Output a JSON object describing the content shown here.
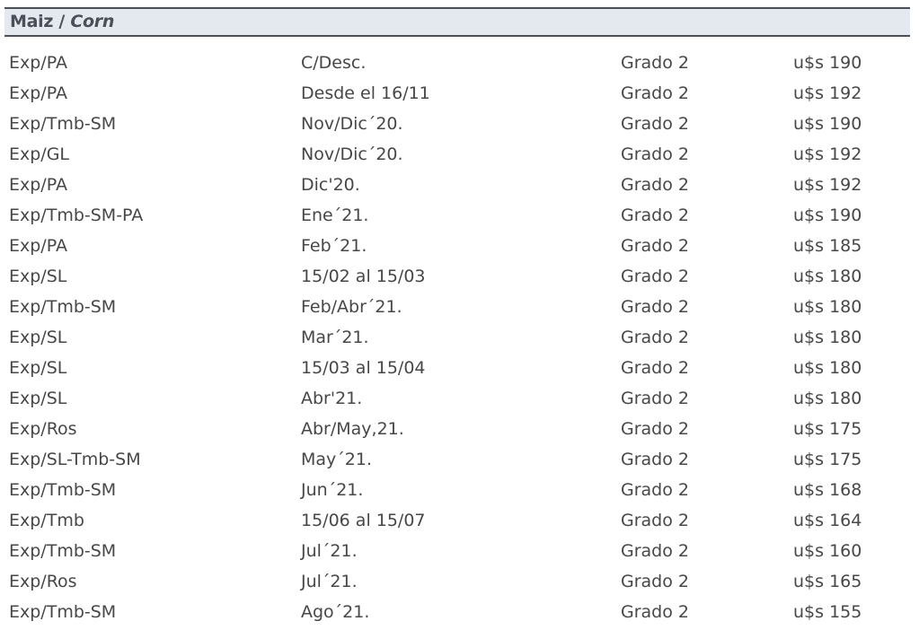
{
  "section": {
    "title_es": "Maiz",
    "separator": " / ",
    "title_en": "Corn"
  },
  "rows": [
    [
      "Exp/PA",
      "C/Desc.",
      "Grado 2",
      "u$s 190"
    ],
    [
      "Exp/PA",
      "Desde el 16/11",
      "Grado 2",
      "u$s 192"
    ],
    [
      "Exp/Tmb-SM",
      "Nov/Dic´20.",
      "Grado 2",
      "u$s 190"
    ],
    [
      "Exp/GL",
      "Nov/Dic´20.",
      "Grado 2",
      "u$s 192"
    ],
    [
      "Exp/PA",
      "Dic'20.",
      "Grado 2",
      "u$s 192"
    ],
    [
      "Exp/Tmb-SM-PA",
      "Ene´21.",
      "Grado 2",
      "u$s 190"
    ],
    [
      "Exp/PA",
      "Feb´21.",
      "Grado 2",
      "u$s 185"
    ],
    [
      "Exp/SL",
      "15/02 al 15/03",
      "Grado 2",
      "u$s 180"
    ],
    [
      "Exp/Tmb-SM",
      "Feb/Abr´21.",
      "Grado 2",
      "u$s 180"
    ],
    [
      "Exp/SL",
      "Mar´21.",
      "Grado 2",
      "u$s 180"
    ],
    [
      "Exp/SL",
      "15/03 al 15/04",
      "Grado 2",
      "u$s 180"
    ],
    [
      "Exp/SL",
      "Abr'21.",
      "Grado 2",
      "u$s 180"
    ],
    [
      "Exp/Ros",
      "Abr/May,21.",
      "Grado 2",
      "u$s 175"
    ],
    [
      "Exp/SL-Tmb-SM",
      "May´21.",
      "Grado 2",
      "u$s 175"
    ],
    [
      "Exp/Tmb-SM",
      "Jun´21.",
      "Grado 2",
      "u$s 168"
    ],
    [
      "Exp/Tmb",
      "15/06 al 15/07",
      "Grado 2",
      "u$s 164"
    ],
    [
      "Exp/Tmb-SM",
      "Jul´21.",
      "Grado 2",
      "u$s 160"
    ],
    [
      "Exp/Ros",
      "Jul´21.",
      "Grado 2",
      "u$s 165"
    ],
    [
      "Exp/Tmb-SM",
      "Ago´21.",
      "Grado 2",
      "u$s 155"
    ]
  ]
}
